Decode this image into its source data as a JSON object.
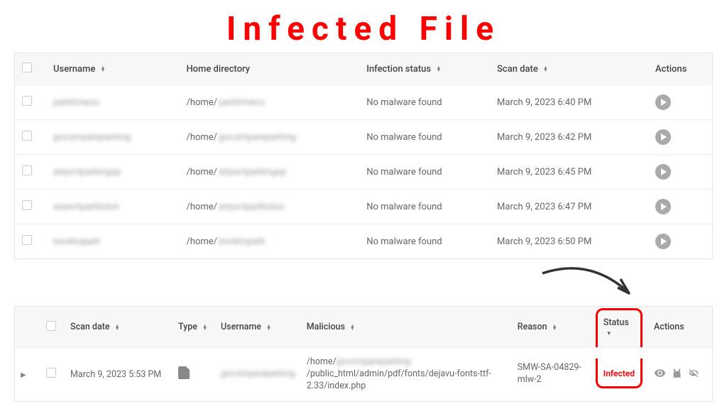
{
  "page_heading": "Infected File",
  "table1": {
    "headers": {
      "username": "Username",
      "home_dir": "Home directory",
      "infection": "Infection status",
      "scan_date": "Scan date",
      "actions": "Actions"
    },
    "rows": [
      {
        "username_blur": "parktimeco",
        "home_prefix": "/home/",
        "home_blur": "parktimeco",
        "infection": "No malware found",
        "scan_date": "March 9, 2023 6:40 PM"
      },
      {
        "username_blur": "gocompareparking",
        "home_prefix": "/home/",
        "home_blur": "gocompareparking",
        "infection": "No malware found",
        "scan_date": "March 9, 2023 6:42 PM"
      },
      {
        "username_blur": "airportparkingsp",
        "home_prefix": "/home/",
        "home_blur": "airportparkingsp",
        "infection": "No malware found",
        "scan_date": "March 9, 2023 6:45 PM"
      },
      {
        "username_blur": "airportparkluton",
        "home_prefix": "/home/",
        "home_blur": "airportparkluton",
        "infection": "No malware found",
        "scan_date": "March 9, 2023 6:47 PM"
      },
      {
        "username_blur": "booktopark",
        "home_prefix": "/home/",
        "home_blur": "booktopark",
        "infection": "No malware found",
        "scan_date": "March 9, 2023 6:50 PM"
      }
    ]
  },
  "table2": {
    "headers": {
      "scan_date": "Scan date",
      "type": "Type",
      "username": "Username",
      "malicious": "Malicious",
      "reason": "Reason",
      "status": "Status",
      "actions": "Actions"
    },
    "row": {
      "scan_date": "March 9, 2023 5:53 PM",
      "username_blur": "gocompareparking",
      "malicious_prefix": "/home/",
      "malicious_blur": "gocompareparking",
      "malicious_suffix": "/public_html/admin/pdf/fonts/dejavu-fonts-ttf-2.33/index.php",
      "reason": "SMW-SA-04829-mlw-2",
      "status": "Infected"
    }
  }
}
